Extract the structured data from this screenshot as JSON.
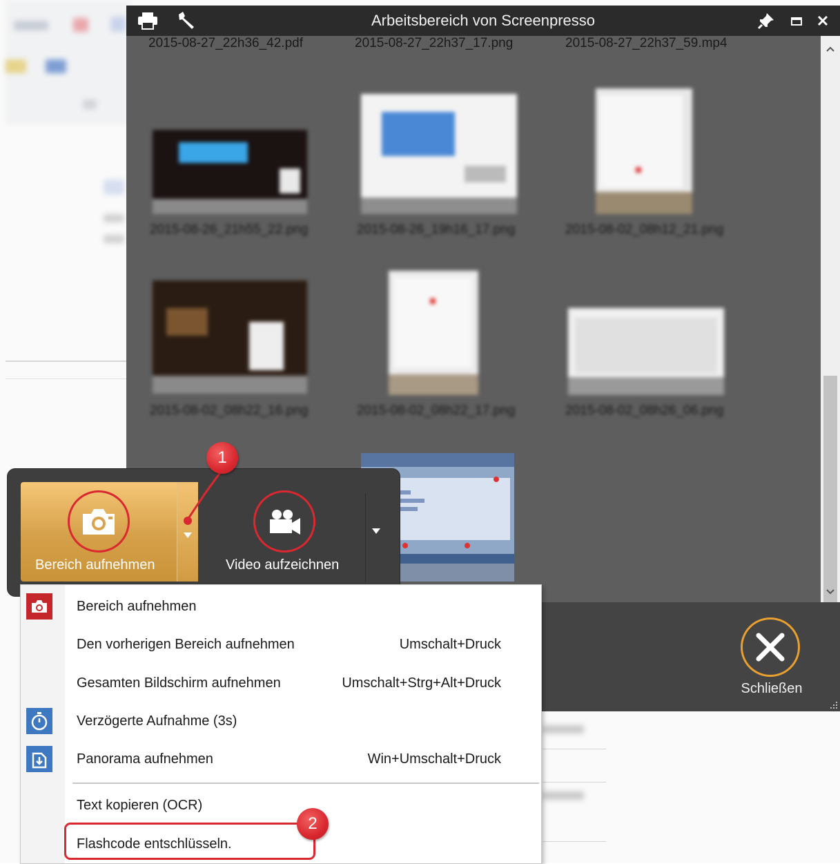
{
  "window": {
    "title": "Arbeitsbereich von Screenpresso",
    "toolbar_icons": [
      "printer-icon",
      "wrench-icon"
    ],
    "title_controls": [
      "pin-icon",
      "restore-icon",
      "close-icon"
    ]
  },
  "gallery": {
    "top_row_files": [
      "2015-08-27_22h36_42.pdf",
      "2015-08-27_22h37_17.png",
      "2015-08-27_22h37_59.mp4"
    ],
    "blurred_row1_names": [
      "2015-08-26_21h55_22.png",
      "2015-08-26_19h16_17.png",
      "2015-08-02_08h12_21.png"
    ],
    "blurred_row2_names": [
      "2015-08-02_08h22_16.png",
      "2015-08-02_08h22_17.png",
      "2015-08-02_08h26_06.png"
    ]
  },
  "bottom": {
    "close_label": "Schließen"
  },
  "capture_panel": {
    "capture_area_label": "Bereich aufnehmen",
    "video_label": "Video aufzeichnen"
  },
  "menu": {
    "items": [
      {
        "label": "Bereich aufnehmen",
        "shortcut": "",
        "icon": "camera-icon"
      },
      {
        "label": "Den vorherigen Bereich aufnehmen",
        "shortcut": "Umschalt+Druck",
        "icon": ""
      },
      {
        "label": "Gesamten Bildschirm aufnehmen",
        "shortcut": "Umschalt+Strg+Alt+Druck",
        "icon": ""
      },
      {
        "label": "Verzögerte Aufnahme (3s)",
        "shortcut": "",
        "icon": "timer-icon"
      },
      {
        "label": "Panorama aufnehmen",
        "shortcut": "Win+Umschalt+Druck",
        "icon": "panorama-icon"
      },
      {
        "label": "Text kopieren (OCR)",
        "shortcut": "",
        "icon": ""
      },
      {
        "label": "Flashcode entschlüsseln.",
        "shortcut": "",
        "icon": ""
      }
    ]
  },
  "annotations": {
    "badge1": "1",
    "badge2": "2"
  },
  "colors": {
    "accent_orange": "#e8a030",
    "annotation_red": "#d9282f",
    "titlebar": "#2b2b2b",
    "gallery_bg": "#5e5e5e"
  }
}
